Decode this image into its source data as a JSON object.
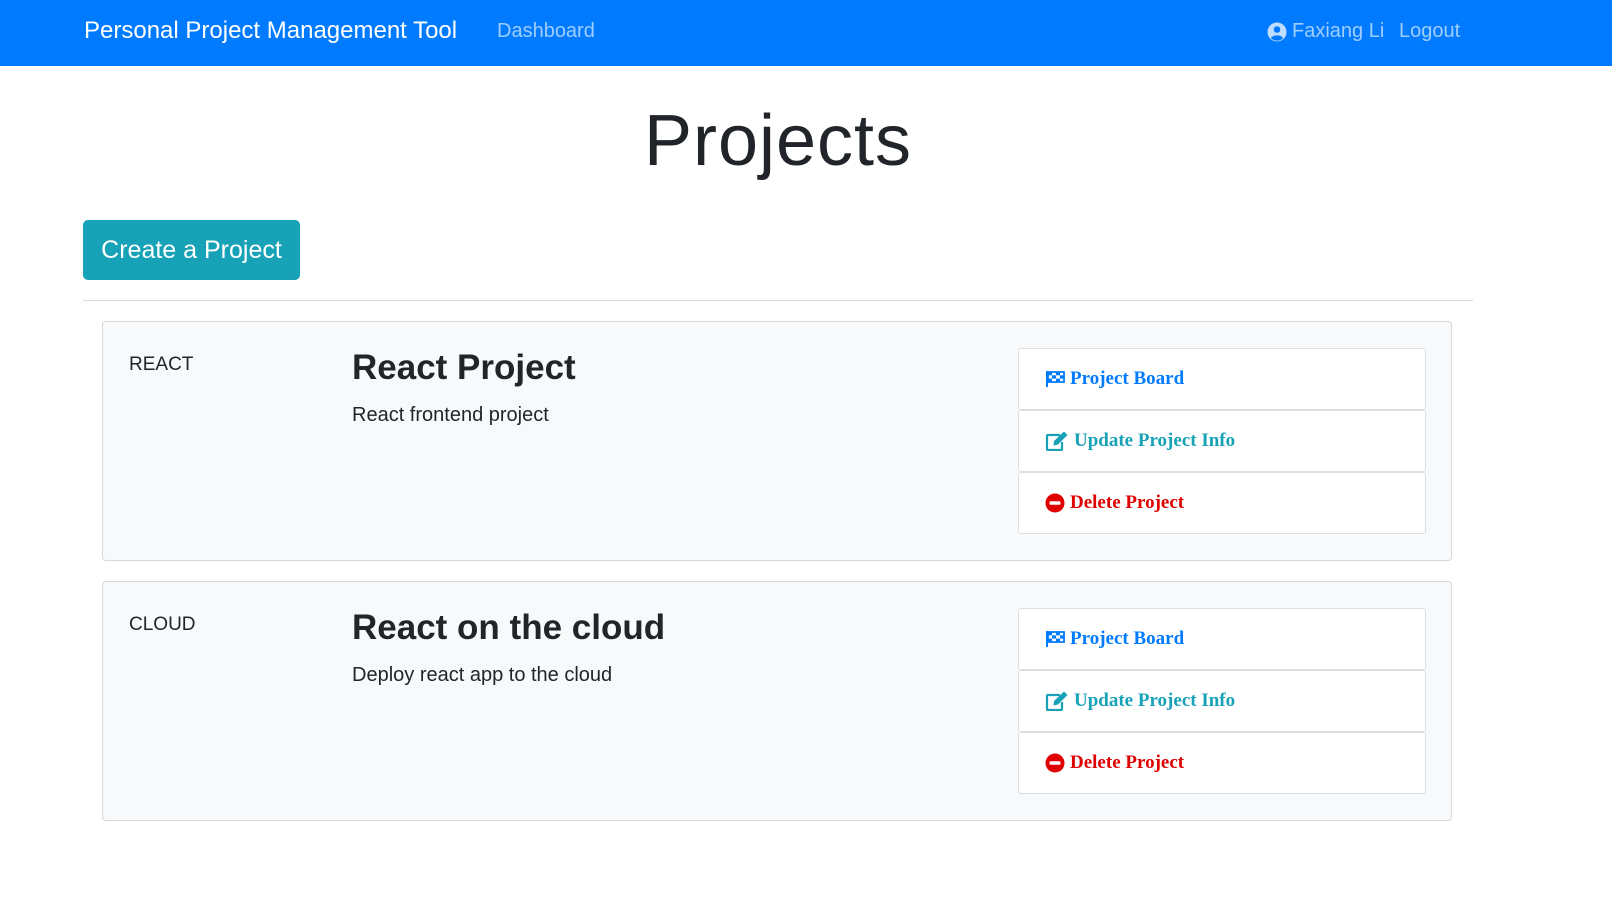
{
  "navbar": {
    "brand": "Personal Project Management Tool",
    "dashboard": "Dashboard",
    "user_name": "Faxiang Li",
    "logout": "Logout"
  },
  "page": {
    "title": "Projects",
    "create_button": "Create a Project"
  },
  "projects": [
    {
      "key": "REACT",
      "name": "React Project",
      "description": "React frontend project",
      "actions": {
        "board": "Project Board",
        "update": "Update Project Info",
        "delete": "Delete Project"
      }
    },
    {
      "key": "CLOUD",
      "name": "React on the cloud",
      "description": "Deploy react app to the cloud",
      "actions": {
        "board": "Project Board",
        "update": "Update Project Info",
        "delete": "Delete Project"
      }
    }
  ],
  "icons": {
    "user": "user-circle-icon",
    "board": "flag-checkered-icon",
    "update": "edit-icon",
    "delete": "minus-circle-icon"
  },
  "colors": {
    "navbar": "#007bff",
    "create_button": "#17a2b8",
    "board_link": "#007bff",
    "update_link": "#17a2b8",
    "delete_link": "#e00000"
  }
}
